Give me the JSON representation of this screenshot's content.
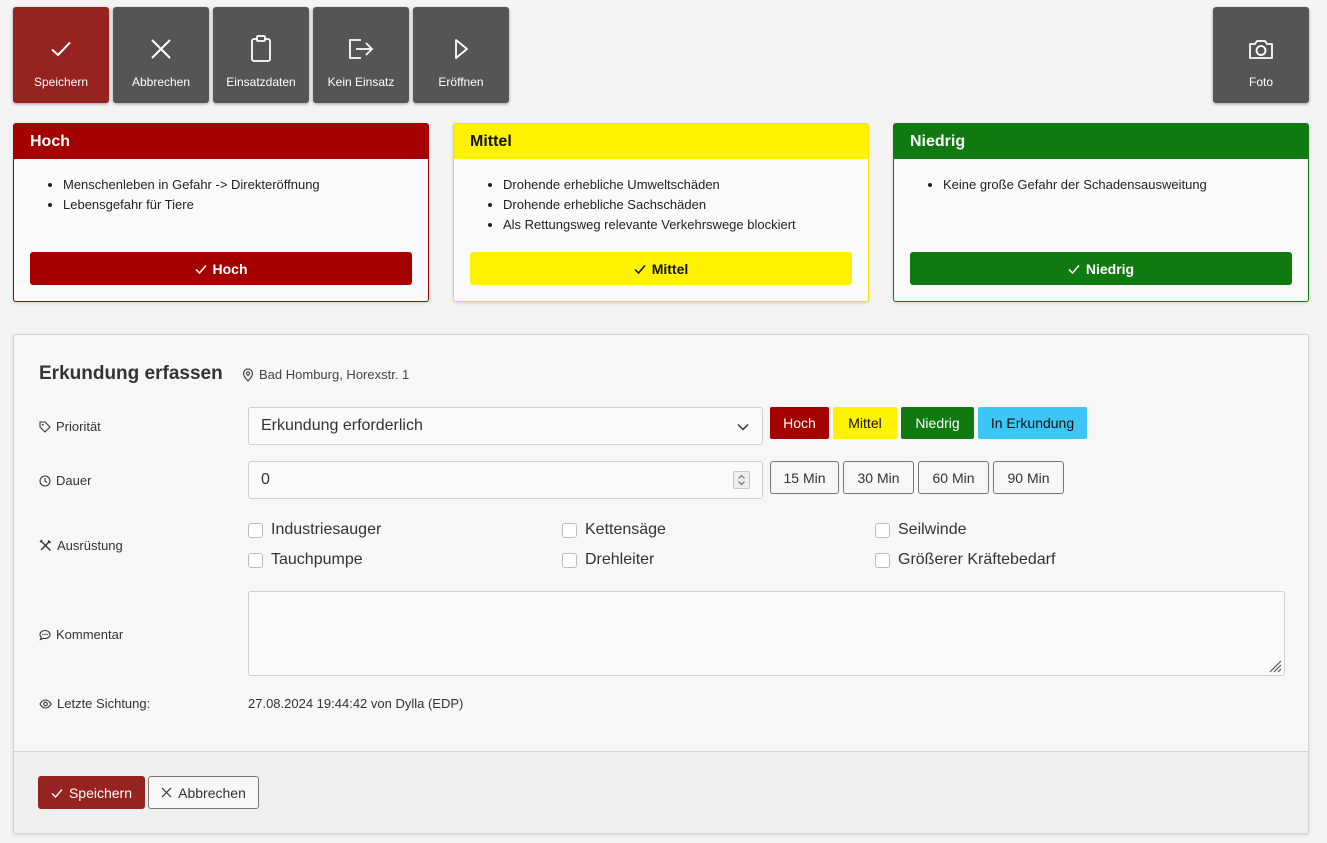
{
  "toolbar": {
    "buttons": [
      {
        "label": "Speichern",
        "icon": "check-icon"
      },
      {
        "label": "Abbrechen",
        "icon": "close-icon"
      },
      {
        "label": "Einsatzdaten",
        "icon": "clipboard-icon"
      },
      {
        "label": "Kein Einsatz",
        "icon": "logout-icon"
      },
      {
        "label": "Eröffnen",
        "icon": "play-icon"
      }
    ],
    "photo": {
      "label": "Foto",
      "icon": "camera-icon"
    }
  },
  "priority_cards": [
    {
      "title": "Hoch",
      "items": [
        "Menschenleben in Gefahr -> Direkteröffnung",
        "Lebensgefahr für Tiere"
      ],
      "button": "Hoch",
      "color": "#a50000"
    },
    {
      "title": "Mittel",
      "items": [
        "Drohende erhebliche Umweltschäden",
        "Drohende erhebliche Sachschäden",
        "Als Rettungsweg relevante Verkehrswege blockiert"
      ],
      "button": "Mittel",
      "color": "#fff200"
    },
    {
      "title": "Niedrig",
      "items": [
        "Keine große Gefahr der Schadensausweitung"
      ],
      "button": "Niedrig",
      "color": "#107a10"
    }
  ],
  "form": {
    "title": "Erkundung erfassen",
    "location": "Bad Homburg, Horexstr. 1",
    "prioritaet": {
      "label": "Priorität",
      "selected": "Erkundung erforderlich",
      "quick_buttons": [
        {
          "label": "Hoch",
          "color": "#a50000"
        },
        {
          "label": "Mittel",
          "color": "#fff200"
        },
        {
          "label": "Niedrig",
          "color": "#107a10"
        },
        {
          "label": "In Erkundung",
          "color": "#3dc6f5"
        }
      ]
    },
    "dauer": {
      "label": "Dauer",
      "value": "0",
      "presets": [
        "15 Min",
        "30 Min",
        "60 Min",
        "90 Min"
      ]
    },
    "ausruestung": {
      "label": "Ausrüstung",
      "options": [
        "Industriesauger",
        "Kettensäge",
        "Seilwinde",
        "Tauchpumpe",
        "Drehleiter",
        "Größerer Kräftebedarf"
      ]
    },
    "kommentar": {
      "label": "Kommentar",
      "value": ""
    },
    "letzte_sichtung": {
      "label": "Letzte Sichtung:",
      "value": "27.08.2024 19:44:42 von Dylla (EDP)"
    }
  },
  "footer": {
    "save_label": "Speichern",
    "cancel_label": "Abbrechen"
  }
}
